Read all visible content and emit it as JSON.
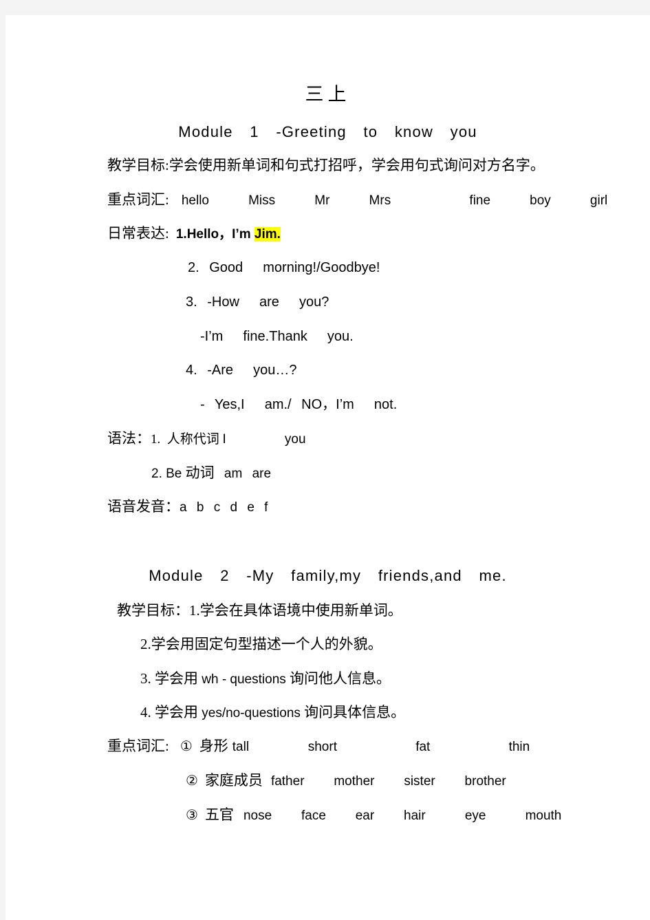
{
  "page": {
    "background_color": "#f4f4f4",
    "paper_color": "#ffffff",
    "highlight_color": "#ffff00"
  },
  "document": {
    "title": "三上"
  },
  "module1": {
    "heading": "Module  1  -Greeting  to  know  you",
    "objectives_label": "教学目标:",
    "objectives_text": "学会使用新单词和句式打招呼，学会用句式询问对方名字。",
    "vocab_label": "重点词汇:",
    "vocab_words": "hello    Miss    Mr    Mrs        fine    boy    girl",
    "daily_label": "日常表达:",
    "daily_items": [
      {
        "prefix": "1.Hello，I’m ",
        "highlight": "Jim."
      },
      {
        "prefix": "2. Good  morning!/Goodbye!",
        "highlight": ""
      },
      {
        "prefix": "3. -How  are  you?",
        "highlight": ""
      },
      {
        "prefix": "-I’m  fine.Thank  you.",
        "highlight": ""
      },
      {
        "prefix": "4. -Are  you…?",
        "highlight": ""
      },
      {
        "prefix": "- Yes,I  am./ NO，I’m  not.",
        "highlight": ""
      }
    ],
    "grammar_label": "语法：",
    "grammar_item1_cn": "1.  人称代词 ",
    "grammar_item1_en": "I    you",
    "grammar_item2_en1": "2. Be ",
    "grammar_item2_cn": "动词",
    "grammar_item2_en2": " am are",
    "phonics_label": "语音发音：",
    "phonics_letters": "a b c d e f"
  },
  "module2": {
    "heading": "Module  2  -My  family,my  friends,and  me.",
    "objectives_label": "教学目标：",
    "objectives": [
      {
        "cn_before": "1.学会在具体语境中使用新单词。",
        "en": "",
        "cn_after": ""
      },
      {
        "cn_before": "2.学会用固定句型描述一个人的外貌。",
        "en": "",
        "cn_after": ""
      },
      {
        "cn_before": "3. 学会用 ",
        "en": "wh - questions",
        "cn_after": " 询问他人信息。"
      },
      {
        "cn_before": "4. 学会用 ",
        "en": "yes/no-questions",
        "cn_after": " 询问具体信息。"
      }
    ],
    "vocab_label": "重点词汇:",
    "vocab_groups": [
      {
        "marker": "①",
        "category": "身形",
        "words": "tall      short        fat        thin"
      },
      {
        "marker": "②",
        "category": "家庭成员",
        "words": "father   mother   sister   brother"
      },
      {
        "marker": "③",
        "category": "五官",
        "words": "nose   face   ear   hair    eye    mouth"
      }
    ]
  }
}
